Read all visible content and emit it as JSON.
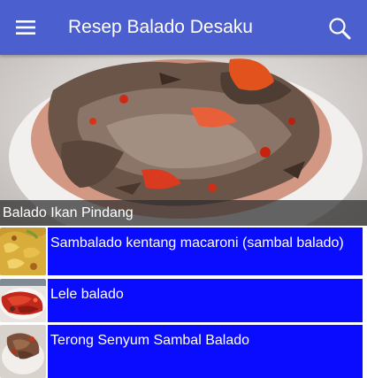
{
  "appbar": {
    "title": "Resep Balado Desaku",
    "menu_icon": "hamburger-menu-icon",
    "search_icon": "search-icon",
    "background_color": "#4c5fcf"
  },
  "featured": {
    "caption": "Balado Ikan Pindang",
    "image": "balado-ikan-pindang-photo"
  },
  "recipes": [
    {
      "title": "Sambalado kentang macaroni (sambal balado)",
      "thumbnail": "potato-macaroni-thumbnail"
    },
    {
      "title": "Lele balado",
      "thumbnail": "catfish-balado-thumbnail"
    },
    {
      "title": "Terong Senyum Sambal Balado",
      "thumbnail": "eggplant-balado-thumbnail"
    }
  ],
  "colors": {
    "list_item_background": "#0a0cff",
    "list_item_text": "#ffffff",
    "caption_overlay": "#2d2d2d"
  }
}
